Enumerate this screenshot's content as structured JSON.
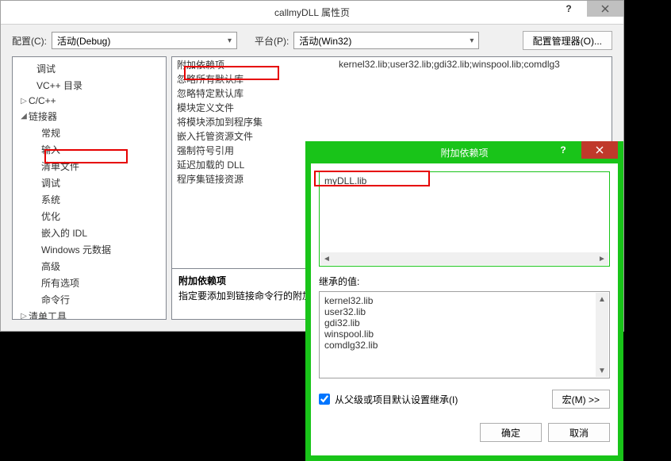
{
  "main": {
    "title": "callmyDLL 属性页",
    "config_label": "配置(C):",
    "config_value": "活动(Debug)",
    "platform_label": "平台(P):",
    "platform_value": "活动(Win32)",
    "config_mgr_btn": "配置管理器(O)...",
    "tree": {
      "items": [
        {
          "label": "调试",
          "depth": "d0"
        },
        {
          "label": "VC++ 目录",
          "depth": "d0"
        },
        {
          "label": "C/C++",
          "depth": "d1t",
          "twisty": "▷"
        },
        {
          "label": "链接器",
          "depth": "d1t",
          "twisty": "◢"
        },
        {
          "label": "常规",
          "depth": "d2"
        },
        {
          "label": "输入",
          "depth": "d2",
          "selected": true
        },
        {
          "label": "清单文件",
          "depth": "d2"
        },
        {
          "label": "调试",
          "depth": "d2"
        },
        {
          "label": "系统",
          "depth": "d2"
        },
        {
          "label": "优化",
          "depth": "d2"
        },
        {
          "label": "嵌入的 IDL",
          "depth": "d2"
        },
        {
          "label": "Windows 元数据",
          "depth": "d2"
        },
        {
          "label": "高级",
          "depth": "d2"
        },
        {
          "label": "所有选项",
          "depth": "d2"
        },
        {
          "label": "命令行",
          "depth": "d2"
        },
        {
          "label": "清单工具",
          "depth": "d1t",
          "twisty": "▷"
        }
      ]
    },
    "grid": {
      "rows": [
        {
          "label": "附加依赖项",
          "value": "kernel32.lib;user32.lib;gdi32.lib;winspool.lib;comdlg3"
        },
        {
          "label": "忽略所有默认库",
          "value": ""
        },
        {
          "label": "忽略特定默认库",
          "value": ""
        },
        {
          "label": "模块定义文件",
          "value": ""
        },
        {
          "label": "将模块添加到程序集",
          "value": ""
        },
        {
          "label": "嵌入托管资源文件",
          "value": ""
        },
        {
          "label": "强制符号引用",
          "value": ""
        },
        {
          "label": "延迟加载的 DLL",
          "value": ""
        },
        {
          "label": "程序集链接资源",
          "value": ""
        }
      ],
      "desc_title": "附加依赖项",
      "desc_body": "指定要添加到链接命令行的附加"
    }
  },
  "popup": {
    "title": "附加依赖项",
    "input_value": "myDLL.lib",
    "inherit_label": "继承的值:",
    "inherit_values": [
      "kernel32.lib",
      "user32.lib",
      "gdi32.lib",
      "winspool.lib",
      "comdlg32.lib"
    ],
    "checkbox_label": "从父级或项目默认设置继承(I)",
    "checkbox_checked": true,
    "macro_btn": "宏(M) >>",
    "ok_btn": "确定",
    "cancel_btn": "取消"
  }
}
